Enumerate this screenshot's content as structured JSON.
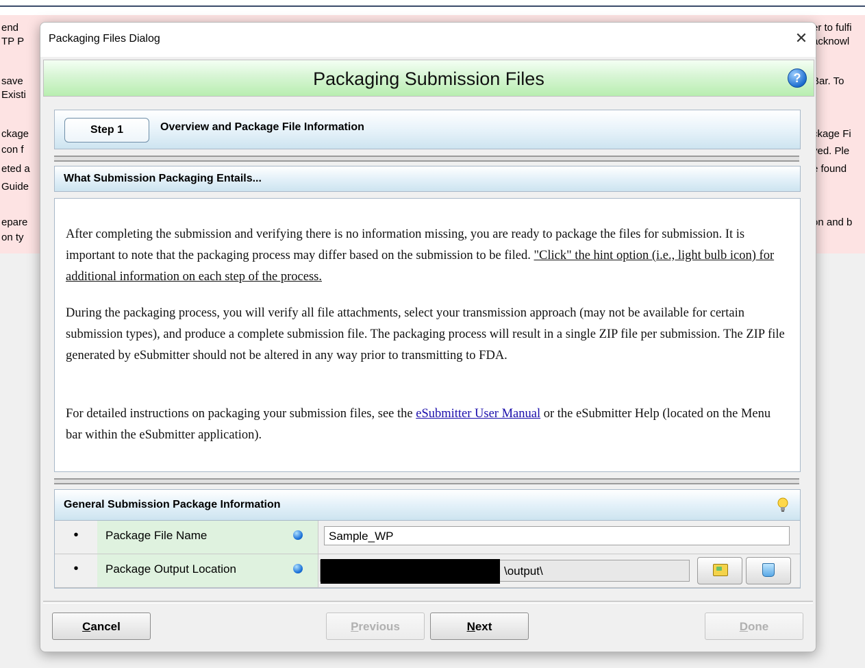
{
  "background": {
    "left_lines": [
      "end",
      "TP P",
      "save",
      "Existi",
      "ckage",
      "con f",
      "eted a",
      "Guide",
      "epare",
      "on ty"
    ],
    "right_lines": [
      "er to fulfi",
      "acknowl",
      "Bar.  To",
      "ckage Fi",
      "yed.  Ple",
      "e found",
      "on and b"
    ]
  },
  "dialog": {
    "title": "Packaging Files Dialog",
    "close_glyph": "✕",
    "banner_title": "Packaging Submission Files",
    "help_glyph": "?"
  },
  "step": {
    "label": "Step 1",
    "description": "Overview and Package File Information"
  },
  "section1": {
    "title": "What Submission Packaging Entails...",
    "p1_text": "After completing the submission and verifying there is no information missing, you are ready to package the files for submission. It is important to note that the packaging process may differ based on the submission to be filed. ",
    "p1_underlined": "\"Click\" the hint option (i.e., light bulb icon) for additional information on each step of the process.",
    "p2_text": "During the packaging process, you will verify all file attachments, select your transmission approach (may not be available for certain submission types), and produce a complete submission file. The packaging process will result in a single ZIP file per submission. The ZIP file generated by eSubmitter should not be altered in any way prior to transmitting to FDA.",
    "p3_before": "For detailed instructions on packaging your submission files, see the ",
    "p3_link": "eSubmitter User Manual",
    "p3_after": " or the eSubmitter Help (located on the Menu bar within the eSubmitter application)."
  },
  "section2": {
    "title": "General Submission Package Information",
    "rows": [
      {
        "bullet": "•",
        "label": "Package File Name",
        "value": "Sample_WP"
      },
      {
        "bullet": "•",
        "label": "Package Output Location",
        "value": "\\output\\"
      }
    ]
  },
  "buttons": {
    "cancel": {
      "underlined": "C",
      "rest": "ancel"
    },
    "previous": {
      "underlined": "P",
      "rest": "revious"
    },
    "next": {
      "underlined": "N",
      "rest": "ext"
    },
    "done": {
      "underlined": "D",
      "rest": "one"
    }
  },
  "colors": {
    "banner_green": "#b8eeb0",
    "label_green": "#dff2df",
    "header_blue": "#cde4f0",
    "link_blue": "#1a0dab",
    "required_dot": "#1a70d8"
  }
}
